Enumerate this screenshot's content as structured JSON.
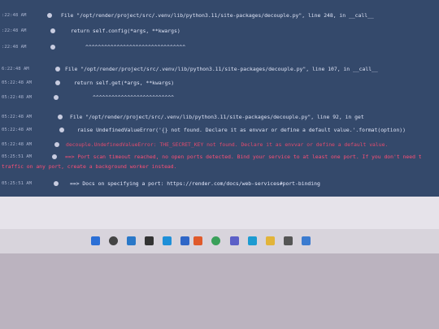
{
  "log_rows": [
    {
      "ts": ":22:48 AM",
      "msg": "File \"/opt/render/project/src/.venv/lib/python3.11/site-packages/decouple.py\", line 248, in __call__"
    },
    {
      "ts": ":22:48 AM",
      "msg": "return self.config(*args, **kwargs)"
    },
    {
      "ts": ":22:48 AM",
      "msg": "^^^^^^^^^^^^^^^^^^^^^^^^^^^^^^^^"
    },
    {
      "ts": "6:22:48 AM",
      "msg": "File \"/opt/render/project/src/.venv/lib/python3.11/site-packages/decouple.py\", line 107, in __call__"
    },
    {
      "ts": "05:22:48 AM",
      "msg": "return self.get(*args, **kwargs)"
    },
    {
      "ts": "05:22:48 AM",
      "msg": "^^^^^^^^^^^^^^^^^^^^^^^^^^"
    },
    {
      "ts": "05:22:48 AM",
      "msg": "File \"/opt/render/project/src/.venv/lib/python3.11/site-packages/decouple.py\", line 92, in get"
    },
    {
      "ts": "05:22:48 AM",
      "msg": "raise UndefinedValueError('{} not found. Declare it as envvar or define a default value.'.format(option))"
    },
    {
      "ts": "05:22:48 AM",
      "msg": "decouple.UndefinedValueError: THE_SECRET_KEY not found. Declare it as envvar or define a default value."
    },
    {
      "ts": "05:25:51 AM",
      "msg": "==> Port scan timeout reached, no open ports detected. Bind your service to at least one port. If you don't need t"
    },
    {
      "ts": "",
      "msg": "traffic on any port, create a background worker instead."
    },
    {
      "ts": "05:25:51 AM",
      "msg": "==> Docs on specifying a port: https://render.com/docs/web-services#port-binding"
    }
  ],
  "taskbar_icons": [
    "windows-icon",
    "search-icon",
    "widgets-icon",
    "task-view-icon",
    "browser-icon",
    "mail-icon",
    "office-icon",
    "chrome-icon",
    "teams-icon",
    "edge-icon",
    "explorer-icon",
    "settings-icon",
    "store-icon"
  ],
  "colors": {
    "log_bg": "#34496b",
    "log_text": "#dfe4f6",
    "error_text": "#e44b6e",
    "warning_text": "#ff4f76",
    "taskbar_bg": "#d8d4dc"
  }
}
